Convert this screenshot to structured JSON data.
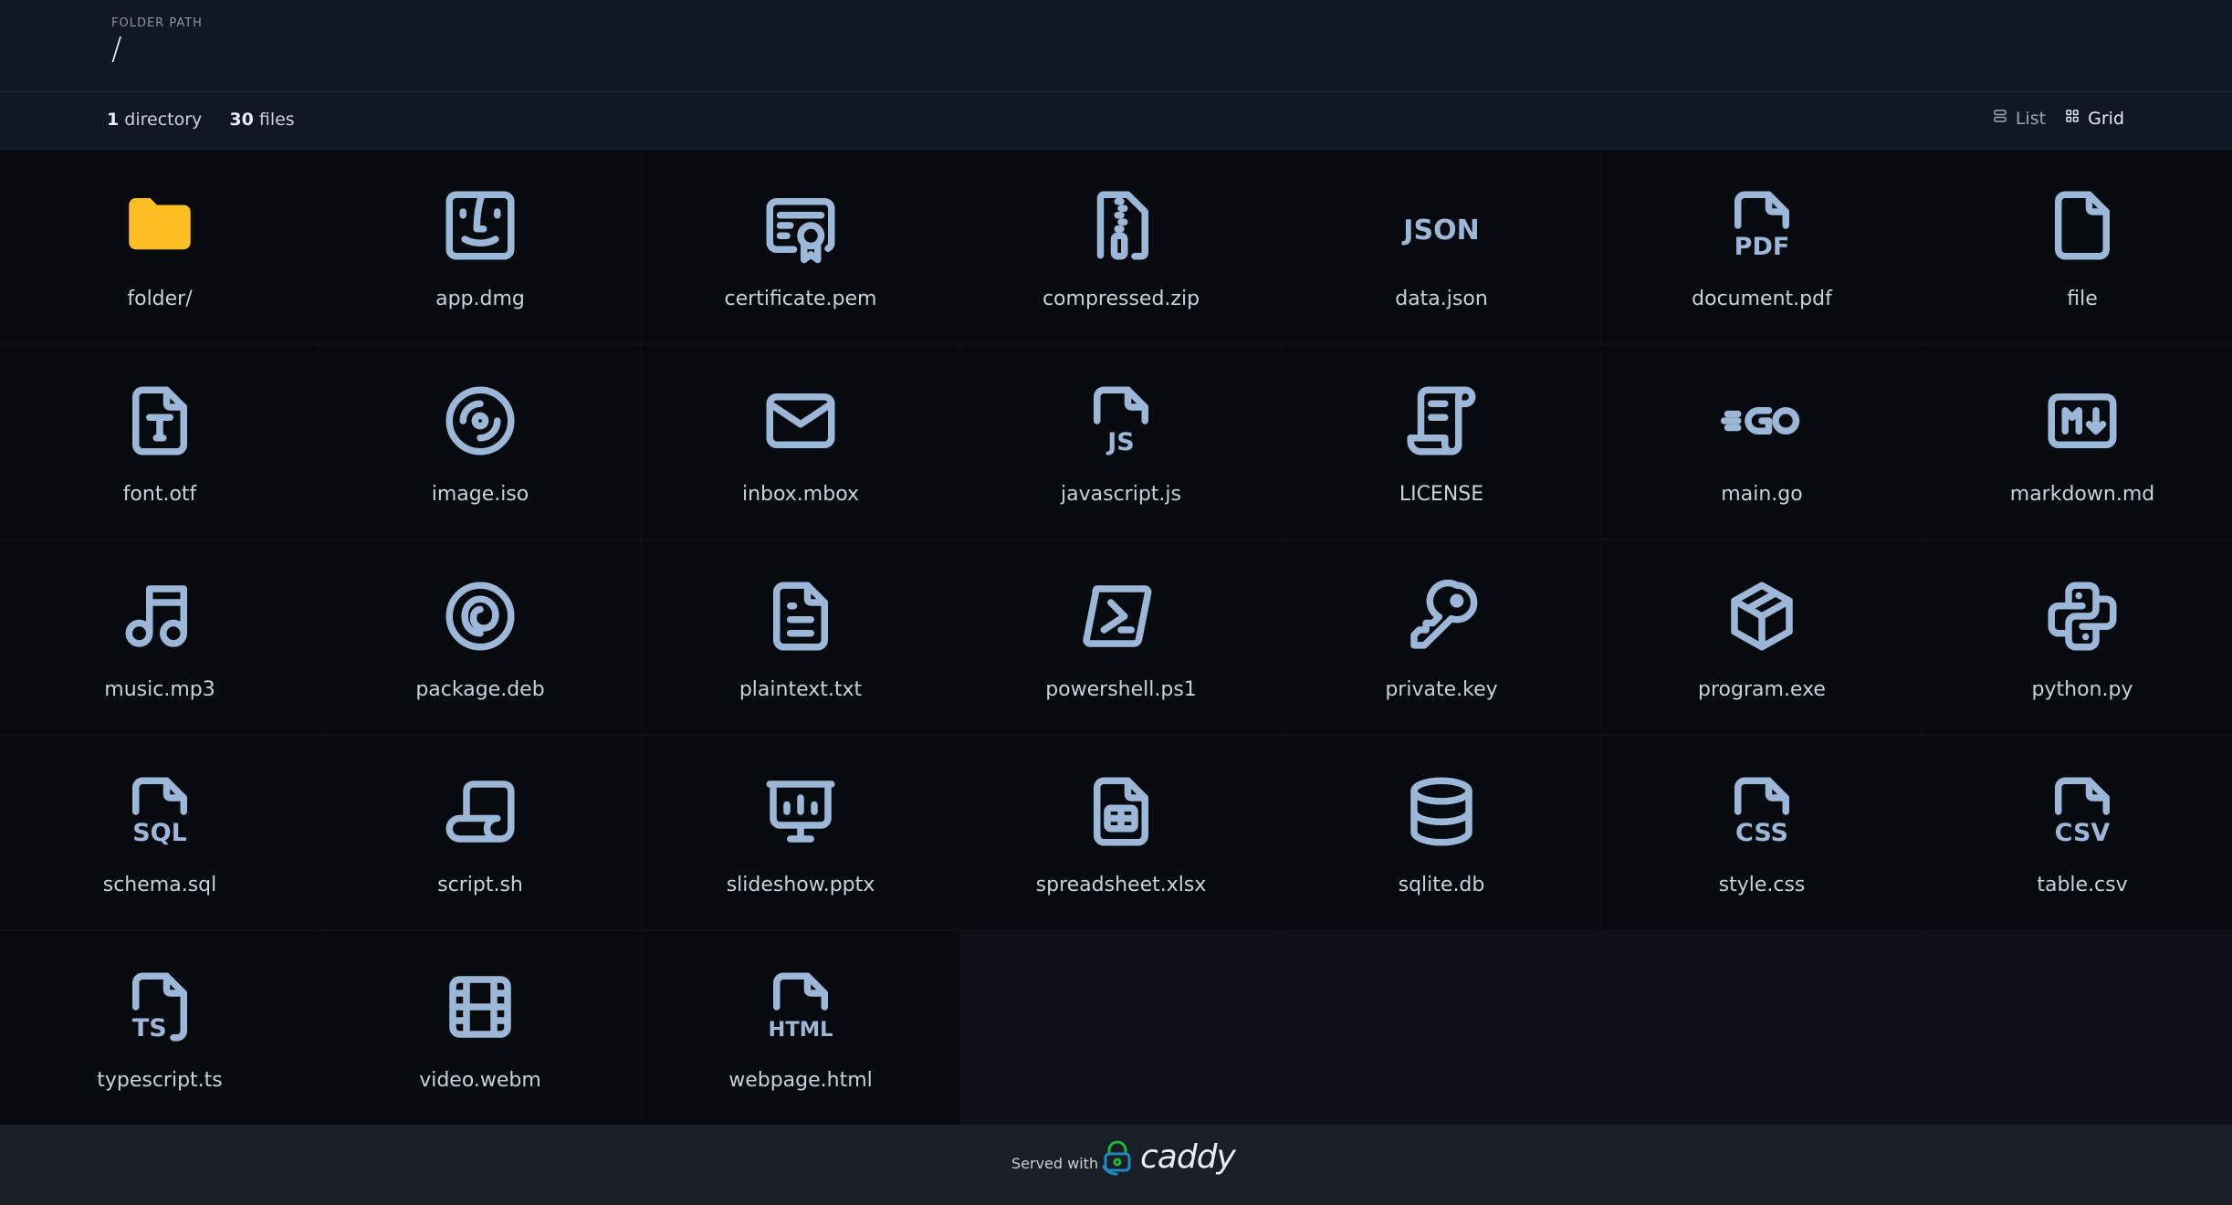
{
  "header": {
    "path_label": "FOLDER PATH",
    "path": "/"
  },
  "summary": {
    "dir_count": "1",
    "dir_label": "directory",
    "file_count": "30",
    "file_label": "files"
  },
  "view": {
    "list_label": "List",
    "grid_label": "Grid",
    "active": "grid"
  },
  "colors": {
    "folder": "#fbbf24",
    "icon": "#9db7d8",
    "background": "#0d1117"
  },
  "files": [
    {
      "name": "folder/",
      "icon": "folder-icon"
    },
    {
      "name": "app.dmg",
      "icon": "finder-icon"
    },
    {
      "name": "certificate.pem",
      "icon": "certificate-icon"
    },
    {
      "name": "compressed.zip",
      "icon": "zip-icon"
    },
    {
      "name": "data.json",
      "icon": "json-icon"
    },
    {
      "name": "document.pdf",
      "icon": "pdf-icon"
    },
    {
      "name": "file",
      "icon": "file-icon"
    },
    {
      "name": "font.otf",
      "icon": "font-file-icon"
    },
    {
      "name": "image.iso",
      "icon": "disc-icon"
    },
    {
      "name": "inbox.mbox",
      "icon": "mail-icon"
    },
    {
      "name": "javascript.js",
      "icon": "js-file-icon"
    },
    {
      "name": "LICENSE",
      "icon": "license-icon"
    },
    {
      "name": "main.go",
      "icon": "go-icon"
    },
    {
      "name": "markdown.md",
      "icon": "markdown-icon"
    },
    {
      "name": "music.mp3",
      "icon": "music-icon"
    },
    {
      "name": "package.deb",
      "icon": "debian-icon"
    },
    {
      "name": "plaintext.txt",
      "icon": "text-file-icon"
    },
    {
      "name": "powershell.ps1",
      "icon": "powershell-icon"
    },
    {
      "name": "private.key",
      "icon": "key-icon"
    },
    {
      "name": "program.exe",
      "icon": "package-box-icon"
    },
    {
      "name": "python.py",
      "icon": "python-icon"
    },
    {
      "name": "schema.sql",
      "icon": "sql-file-icon"
    },
    {
      "name": "script.sh",
      "icon": "script-icon"
    },
    {
      "name": "slideshow.pptx",
      "icon": "presentation-icon"
    },
    {
      "name": "spreadsheet.xlsx",
      "icon": "spreadsheet-icon"
    },
    {
      "name": "sqlite.db",
      "icon": "database-icon"
    },
    {
      "name": "style.css",
      "icon": "css-file-icon"
    },
    {
      "name": "table.csv",
      "icon": "csv-file-icon"
    },
    {
      "name": "typescript.ts",
      "icon": "ts-file-icon"
    },
    {
      "name": "video.webm",
      "icon": "film-icon"
    },
    {
      "name": "webpage.html",
      "icon": "html-file-icon"
    }
  ],
  "footer": {
    "served_with": "Served with",
    "brand": "caddy"
  }
}
